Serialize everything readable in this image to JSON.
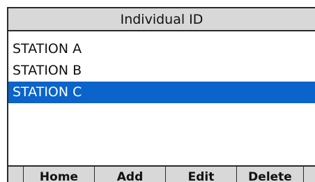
{
  "title": "Individual ID",
  "stations": [
    {
      "label": "STATION A",
      "selected": false
    },
    {
      "label": "STATION B",
      "selected": false
    },
    {
      "label": "STATION C",
      "selected": true
    }
  ],
  "softkeys": [
    "Home",
    "Add",
    "Edit",
    "Delete"
  ],
  "colors": {
    "selection": "#0b63cc",
    "bar": "#d8d8d8"
  }
}
